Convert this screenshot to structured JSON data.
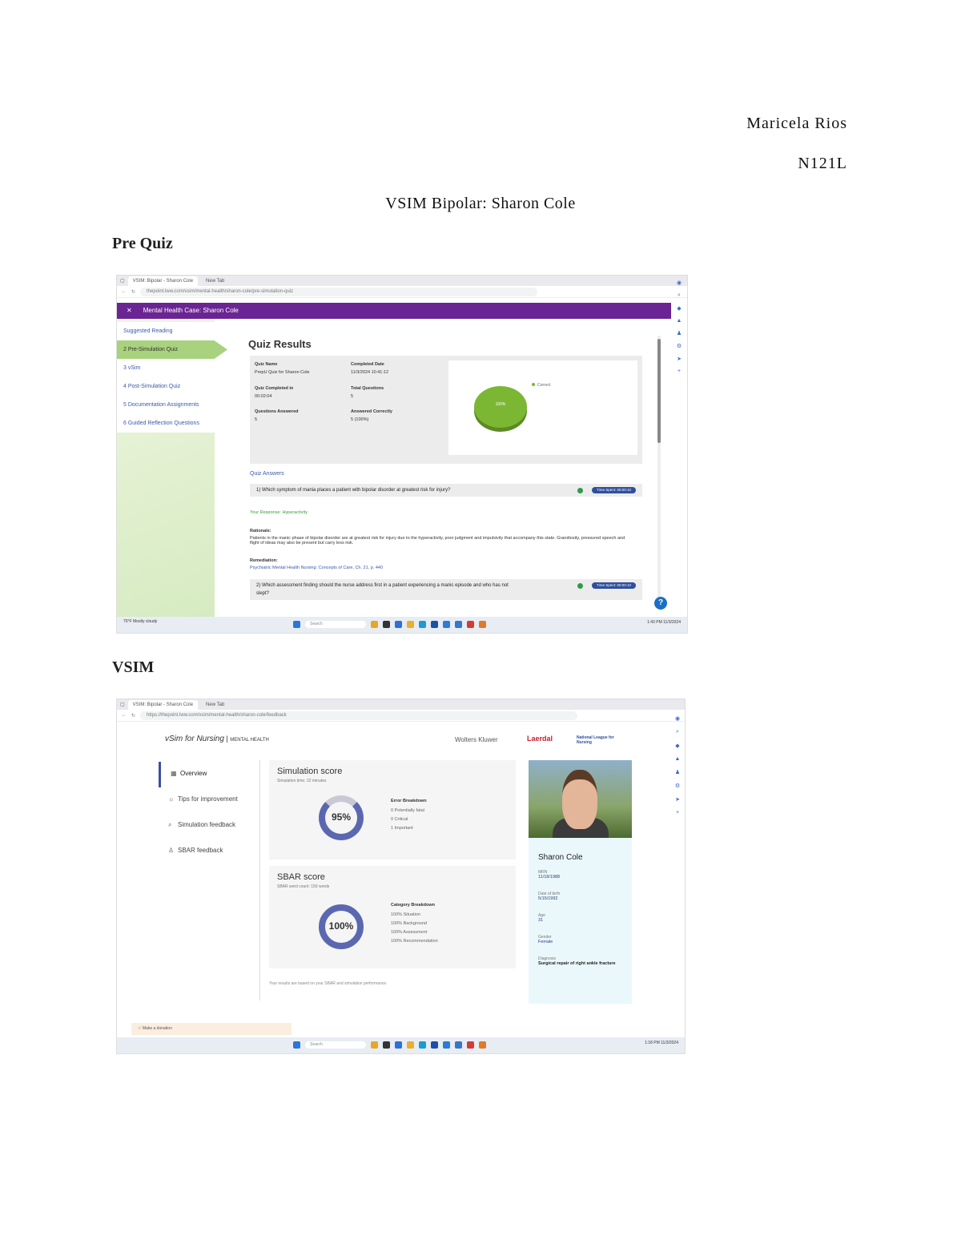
{
  "header": {
    "name": "Maricela Rios",
    "course": "N121L",
    "title": "VSIM Bipolar: Sharon Cole"
  },
  "sections": {
    "prequiz": "Pre Quiz",
    "vsim": "VSIM"
  },
  "shot1": {
    "tab1": "VSIM: Bipolar - Sharon Cole",
    "tab2": "New Tab",
    "url": "thepoint.lww.com/vsim/mental-health/sharon-cole/pre-simulation-quiz",
    "banner": "Mental Health Case: Sharon Cole",
    "menu": [
      "Suggested Reading",
      "2 Pre-Simulation Quiz",
      "3 vSim",
      "4 Post-Simulation Quiz",
      "5 Documentation Assignments",
      "6 Guided Reflection Questions"
    ],
    "quiz_title": "Quiz Results",
    "fields": {
      "quiz_name_label": "Quiz Name",
      "quiz_name": "PrepU Quiz for Sharon Cole",
      "completed_date_label": "Completed Date",
      "completed_date": "11/3/2024 10:41:12",
      "quiz_completed_label": "Quiz Completed in",
      "quiz_completed": "00:02:04",
      "total_questions_label": "Total Questions",
      "total_questions": "5",
      "answered_label": "Questions Answered",
      "answered": "5",
      "answered_correctly_label": "Answered Correctly",
      "answered_correctly": "5 (100%)"
    },
    "pie_label": "100%",
    "pie_legend": "Correct",
    "answers_title": "Quiz Answers",
    "q1": "1) Which symptom of mania places a patient with bipolar disorder at greatest risk for injury?",
    "badge": "Time Spent: 00:00:10",
    "response": "Your Response: Hyperactivity",
    "rationale_label": "Rationale:",
    "rationale": "Patients in the manic phase of bipolar disorder are at greatest risk for injury due to the hyperactivity, poor judgment and impulsivity that accompany this state. Grandiosity, pressured speech and flight of ideas may also be present but carry less risk.",
    "remediation_label": "Remediation:",
    "remediation": "Psychiatric Mental Health Nursing: Concepts of Care, Ch. 21, p. 440",
    "q2": "2) Which assessment finding should the nurse address first in a patient experiencing a manic episode and who has not slept?",
    "help": "?",
    "taskbar_search": "Search",
    "weather": "70°F Mostly cloudy",
    "clock": "1:43 PM 11/3/2024"
  },
  "shot2": {
    "tab1": "VSIM: Bipolar - Sharon Cole",
    "tab2": "New Tab",
    "url": "https://thepoint.lww.com/vsim/mental-health/sharon-cole/feedback",
    "brand": "vSim for Nursing",
    "brand_sub": "MENTAL HEALTH",
    "wk": "Wolters Kluwer",
    "laerdal": "Laerdal",
    "nln": "National League for Nursing",
    "nav": [
      "Overview",
      "Tips for improvement",
      "Simulation feedback",
      "SBAR feedback"
    ],
    "sim_title": "Simulation score",
    "sim_sub": "Simulation time: 22 minutes",
    "sim_score": "95%",
    "error_title": "Error Breakdown",
    "errors": [
      "0 Potentially fatal",
      "0 Critical",
      "1 Important"
    ],
    "sbar_title": "SBAR score",
    "sbar_sub": "SBAR word count: 150 words",
    "sbar_score": "100%",
    "cat_title": "Category Breakdown",
    "categories": [
      "100% Situation",
      "100% Background",
      "100% Assessment",
      "100% Recommendation"
    ],
    "note": "Your results are based on your SBAR and simulation performance.",
    "patient_name": "Sharon Cole",
    "mrn_label": "MRN",
    "mrn": "11/18/1988",
    "dob_label": "Date of birth",
    "dob": "5/15/1992",
    "age_label": "Age",
    "age": "31",
    "gender_label": "Gender",
    "gender": "Female",
    "diag_label": "Diagnosis",
    "diag": "Surgical repair of right ankle fracture",
    "toast": "Make a donation",
    "taskbar_search": "Search",
    "clock": "1:18 PM 11/3/2024"
  }
}
